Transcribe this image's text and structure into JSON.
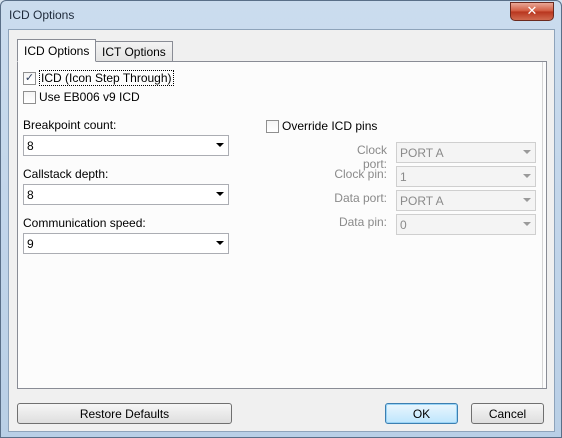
{
  "window": {
    "title": "ICD Options",
    "close_glyph": "✕"
  },
  "tabs": [
    {
      "label": "ICD Options",
      "selected": true
    },
    {
      "label": "ICT Options",
      "selected": false
    }
  ],
  "checkboxes": {
    "icd": {
      "label": "ICD (Icon Step Through)",
      "checked": true,
      "check_glyph": "✓"
    },
    "eb006": {
      "label": "Use EB006 v9 ICD",
      "checked": false
    },
    "override": {
      "label": "Override ICD pins",
      "checked": false
    }
  },
  "left_fields": {
    "breakpoint": {
      "label": "Breakpoint count:",
      "value": "8"
    },
    "callstack": {
      "label": "Callstack depth:",
      "value": "8"
    },
    "comm_speed": {
      "label": "Communication speed:",
      "value": "9"
    }
  },
  "pin_fields": {
    "clock_port": {
      "label": "Clock port:",
      "value": "PORT A"
    },
    "clock_pin": {
      "label": "Clock pin:",
      "value": "1"
    },
    "data_port": {
      "label": "Data port:",
      "value": "PORT A"
    },
    "data_pin": {
      "label": "Data pin:",
      "value": "0"
    }
  },
  "buttons": {
    "restore": "Restore Defaults",
    "ok": "OK",
    "cancel": "Cancel"
  }
}
